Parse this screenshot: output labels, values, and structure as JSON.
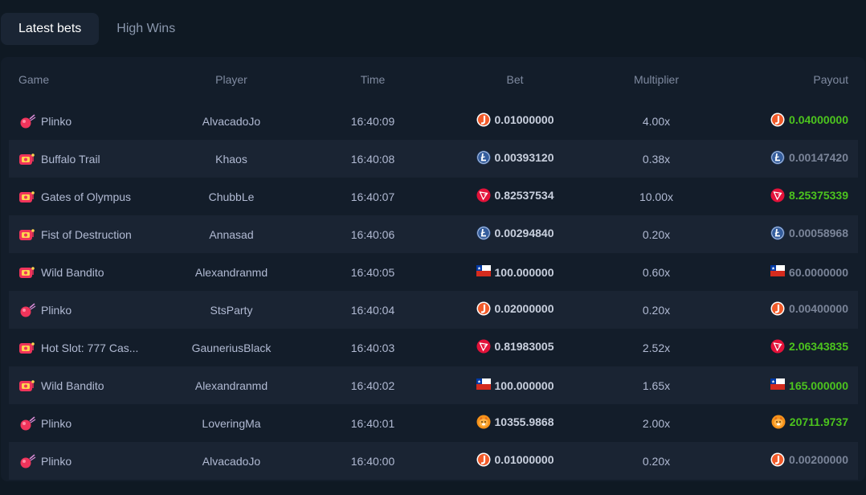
{
  "tabs": [
    {
      "label": "Latest bets",
      "active": true
    },
    {
      "label": "High Wins",
      "active": false
    }
  ],
  "columns": {
    "game": "Game",
    "player": "Player",
    "time": "Time",
    "bet": "Bet",
    "multiplier": "Multiplier",
    "payout": "Payout"
  },
  "colors": {
    "win": "#4cc41e",
    "lose": "#7a8498",
    "accent_plinko": "#f0345b"
  },
  "rows": [
    {
      "game": "Plinko",
      "game_icon": "plinko-icon",
      "player": "AlvacadoJo",
      "time": "16:40:09",
      "currency": "jb-coin-icon",
      "bet": "0.01000000",
      "multiplier": "4.00x",
      "payout": "0.04000000",
      "win": true
    },
    {
      "game": "Buffalo Trail",
      "game_icon": "slot-icon",
      "player": "Khaos",
      "time": "16:40:08",
      "currency": "litecoin-icon",
      "bet": "0.00393120",
      "multiplier": "0.38x",
      "payout": "0.00147420",
      "win": false
    },
    {
      "game": "Gates of Olympus",
      "game_icon": "slot-icon",
      "player": "ChubbLe",
      "time": "16:40:07",
      "currency": "tron-icon",
      "bet": "0.82537534",
      "multiplier": "10.00x",
      "payout": "8.25375339",
      "win": true
    },
    {
      "game": "Fist of Destruction",
      "game_icon": "slot-icon",
      "player": "Annasad",
      "time": "16:40:06",
      "currency": "litecoin-icon",
      "bet": "0.00294840",
      "multiplier": "0.20x",
      "payout": "0.00058968",
      "win": false
    },
    {
      "game": "Wild Bandito",
      "game_icon": "slot-icon",
      "player": "Alexandranmd",
      "time": "16:40:05",
      "currency": "chile-flag-icon",
      "bet": "100.000000",
      "multiplier": "0.60x",
      "payout": "60.0000000",
      "win": false
    },
    {
      "game": "Plinko",
      "game_icon": "plinko-icon",
      "player": "StsParty",
      "time": "16:40:04",
      "currency": "jb-coin-icon",
      "bet": "0.02000000",
      "multiplier": "0.20x",
      "payout": "0.00400000",
      "win": false
    },
    {
      "game": "Hot Slot: 777 Cas...",
      "game_icon": "slot-icon",
      "player": "GauneriusBlack",
      "time": "16:40:03",
      "currency": "tron-icon",
      "bet": "0.81983005",
      "multiplier": "2.52x",
      "payout": "2.06343835",
      "win": true
    },
    {
      "game": "Wild Bandito",
      "game_icon": "slot-icon",
      "player": "Alexandranmd",
      "time": "16:40:02",
      "currency": "chile-flag-icon",
      "bet": "100.000000",
      "multiplier": "1.65x",
      "payout": "165.000000",
      "win": true
    },
    {
      "game": "Plinko",
      "game_icon": "plinko-icon",
      "player": "LoveringMa",
      "time": "16:40:01",
      "currency": "shiba-coin-icon",
      "bet": "10355.9868",
      "multiplier": "2.00x",
      "payout": "20711.9737",
      "win": true
    },
    {
      "game": "Plinko",
      "game_icon": "plinko-icon",
      "player": "AlvacadoJo",
      "time": "16:40:00",
      "currency": "jb-coin-icon",
      "bet": "0.01000000",
      "multiplier": "0.20x",
      "payout": "0.00200000",
      "win": false
    }
  ]
}
